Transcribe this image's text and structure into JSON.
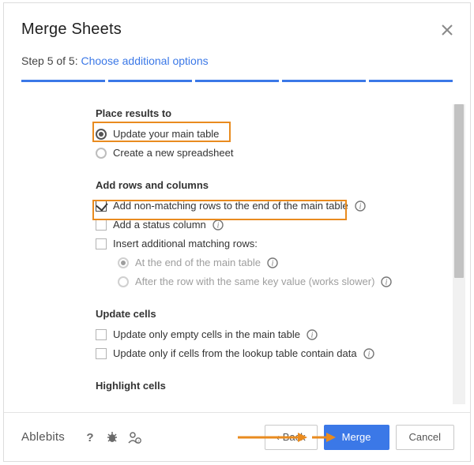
{
  "header": {
    "title": "Merge Sheets",
    "step_prefix": "Step 5 of 5: ",
    "step_link": "Choose additional options"
  },
  "sections": {
    "place": {
      "title": "Place results to",
      "opt_update": "Update your main table",
      "opt_new": "Create a new spreadsheet"
    },
    "rows": {
      "title": "Add rows and columns",
      "opt_nonmatch": "Add non-matching rows to the end of the main table",
      "opt_status": "Add a status column",
      "opt_insert": "Insert additional matching rows:",
      "opt_insert_end": "At the end of the main table",
      "opt_insert_after": "After the row with the same key value (works slower)"
    },
    "cells": {
      "title": "Update cells",
      "opt_empty": "Update only empty cells in the main table",
      "opt_lookup": "Update only if cells from the lookup table contain data"
    },
    "highlight": {
      "title": "Highlight cells"
    }
  },
  "footer": {
    "brand": "Ablebits",
    "back": "Back",
    "merge": "Merge",
    "cancel": "Cancel"
  }
}
